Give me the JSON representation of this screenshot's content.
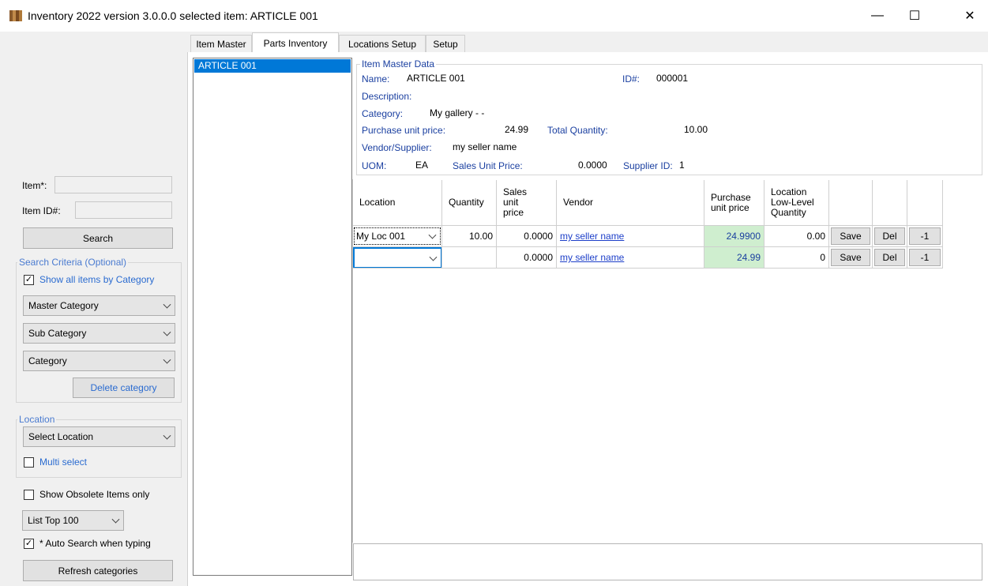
{
  "window": {
    "title": "Inventory 2022 version 3.0.0.0 selected item: ARTICLE 001",
    "minimize": "—",
    "maximize": "☐",
    "close": "✕"
  },
  "left_panel": {
    "item_label": "Item*:",
    "item_value": "",
    "item_id_label": "Item ID#:",
    "item_id_value": "",
    "search_button": "Search",
    "search_criteria": {
      "title": "Search Criteria (Optional)",
      "show_all_by_category": "Show all items by Category",
      "show_all_checked": true,
      "master_category": "Master Category",
      "sub_category": "Sub Category",
      "category": "Category",
      "delete_category": "Delete category"
    },
    "location_group": {
      "title": "Location",
      "select_location": "Select Location",
      "multi_select": "Multi select",
      "multi_select_checked": false
    },
    "show_obsolete": "Show Obsolete Items only",
    "show_obsolete_checked": false,
    "list_top": "List Top 100",
    "auto_search": "* Auto Search when typing",
    "auto_search_checked": true,
    "refresh_categories": "Refresh categories"
  },
  "tabs": [
    {
      "label": "Item Master",
      "active": false
    },
    {
      "label": "Parts Inventory",
      "active": true
    },
    {
      "label": "Locations Setup",
      "active": false
    },
    {
      "label": "Setup",
      "active": false
    }
  ],
  "item_list": [
    "ARTICLE 001"
  ],
  "master_data": {
    "group_title": "Item Master Data",
    "name_label": "Name:",
    "name_value": "ARTICLE 001",
    "id_label": "ID#:",
    "id_value": "000001",
    "description_label": "Description:",
    "description_value": "",
    "category_label": "Category:",
    "category_value": "My gallery -  -",
    "purchase_price_label": "Purchase unit price:",
    "purchase_price_value": "24.99",
    "total_qty_label": "Total Quantity:",
    "total_qty_value": "10.00",
    "vendor_label": "Vendor/Supplier:",
    "vendor_value": "my seller name",
    "uom_label": "UOM:",
    "uom_value": "EA",
    "sales_price_label": "Sales Unit Price:",
    "sales_price_value": "0.0000",
    "supplier_id_label": "Supplier ID:",
    "supplier_id_value": "1"
  },
  "grid": {
    "headers": {
      "location": "Location",
      "quantity": "Quantity",
      "sales_l1": "Sales",
      "sales_l2": "unit",
      "sales_l3": "price",
      "vendor": "Vendor",
      "purchase_l1": "Purchase",
      "purchase_l2": "unit price",
      "lowlevel_l1": "Location",
      "lowlevel_l2": "Low-Level",
      "lowlevel_l3": "Quantity"
    },
    "rows": [
      {
        "location": "My Loc 001",
        "quantity": "10.00",
        "sales_price": "0.0000",
        "vendor": "my seller name",
        "purchase_price": "24.9900",
        "low_level": "0.00",
        "save": "Save",
        "del": "Del",
        "minus": "-1"
      },
      {
        "location": "",
        "quantity": "",
        "sales_price": "0.0000",
        "vendor": "my seller name",
        "purchase_price": "24.99",
        "low_level": "0",
        "save": "Save",
        "del": "Del",
        "minus": "-1"
      }
    ]
  }
}
